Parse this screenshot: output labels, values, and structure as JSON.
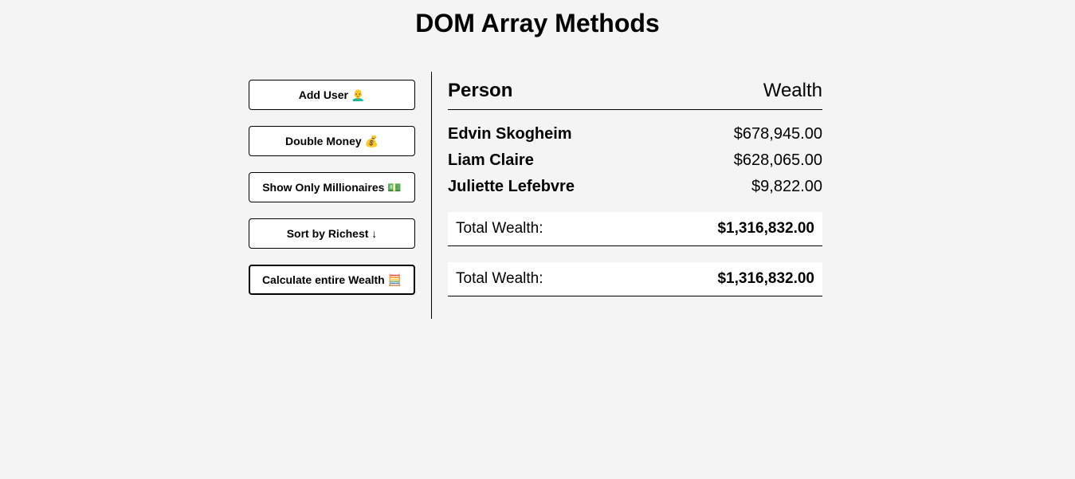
{
  "page": {
    "title": "DOM Array Methods"
  },
  "sidebar": {
    "buttons": [
      {
        "label": "Add User 👨‍🦲",
        "icon": "person-icon"
      },
      {
        "label": "Double Money 💰",
        "icon": "money-bag-icon"
      },
      {
        "label": "Show Only Millionaires 💵",
        "icon": "dollar-banknote-icon"
      },
      {
        "label": "Sort by Richest ↓",
        "icon": "arrow-down-icon"
      },
      {
        "label": "Calculate entire Wealth 🧮",
        "icon": "abacus-icon"
      }
    ]
  },
  "table": {
    "header": {
      "person": "Person",
      "wealth": "Wealth"
    },
    "rows": [
      {
        "name": "Edvin Skogheim",
        "wealth": "$678,945.00"
      },
      {
        "name": "Liam Claire",
        "wealth": "$628,065.00"
      },
      {
        "name": "Juliette Lefebvre",
        "wealth": "$9,822.00"
      }
    ],
    "totals": [
      {
        "label": "Total Wealth:",
        "value": "$1,316,832.00"
      },
      {
        "label": "Total Wealth:",
        "value": "$1,316,832.00"
      }
    ]
  }
}
